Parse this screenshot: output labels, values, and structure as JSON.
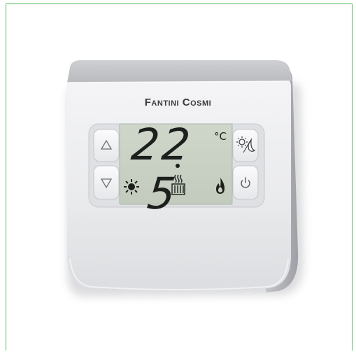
{
  "brand": "Fantini Cosmi",
  "display": {
    "temperature": "22.5",
    "unit": "°C"
  },
  "icons": {
    "left_status": "sun-icon",
    "center_status": "radiator-icon",
    "right_status": "flame-icon",
    "mode_button": "sun-moon-icon",
    "power_button": "power-icon",
    "up_button": "triangle-up-icon",
    "down_button": "triangle-down-icon"
  },
  "colors": {
    "frame": "#56b556",
    "lcd": "#c9d2c4",
    "device": "#e9eaec",
    "digits": "#1c1f1c"
  }
}
